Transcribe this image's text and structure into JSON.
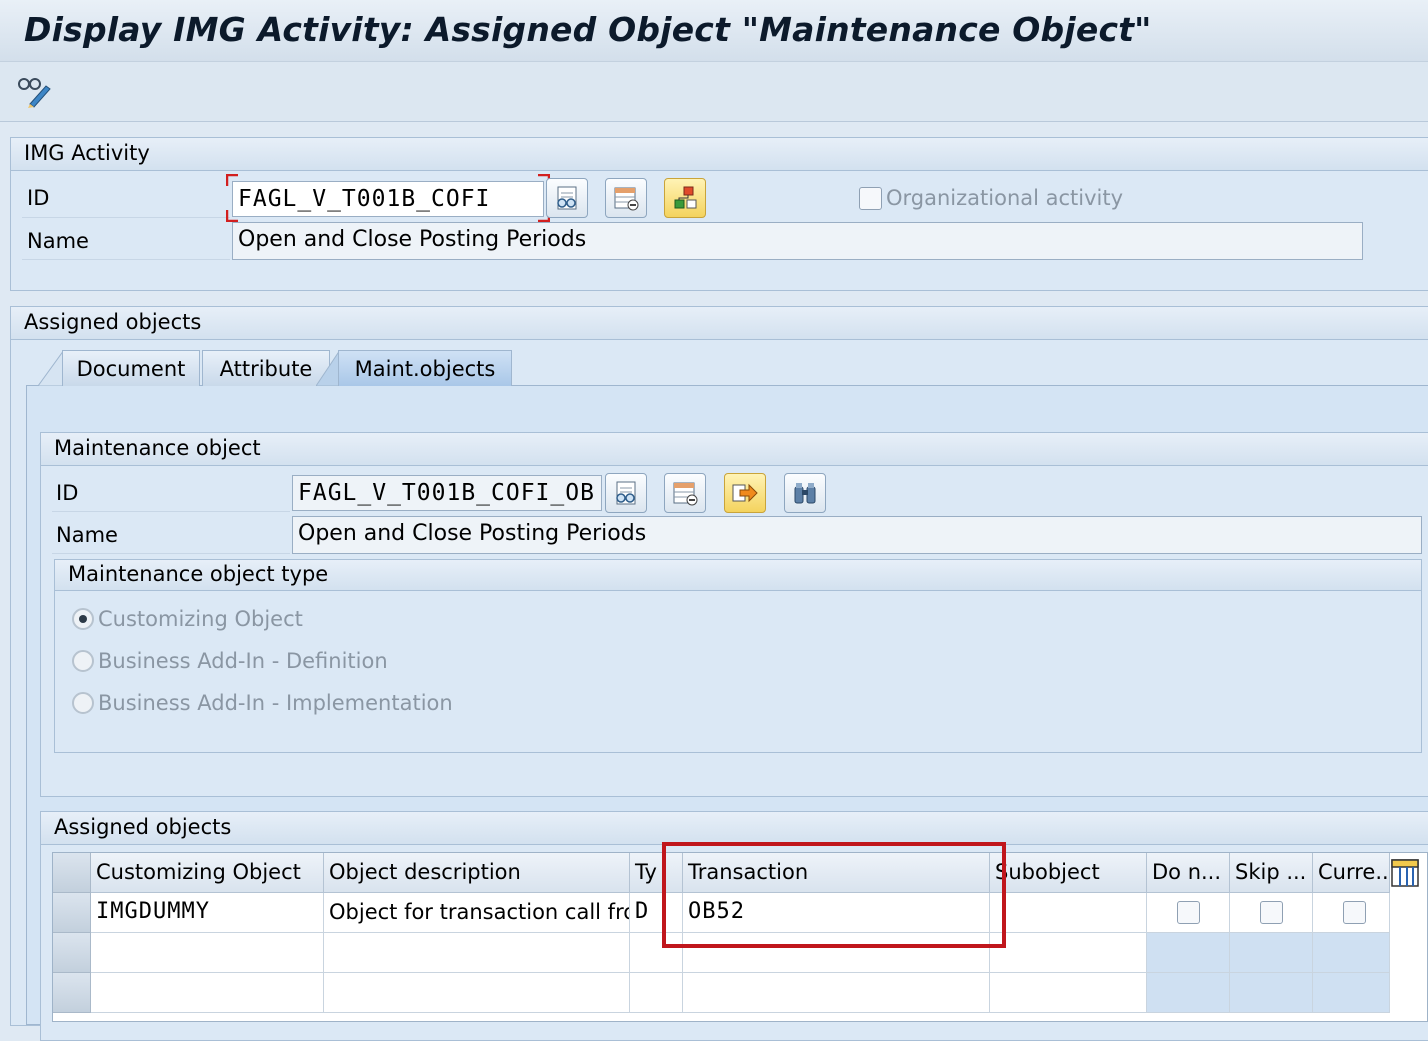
{
  "window": {
    "title": "Display IMG Activity: Assigned Object \"Maintenance Object\""
  },
  "img_activity": {
    "header": "IMG Activity",
    "id_label": "ID",
    "id_value": "FAGL_V_T001B_COFI",
    "name_label": "Name",
    "name_value": "Open and Close Posting Periods",
    "org_activity_label": "Organizational activity"
  },
  "assigned_objects_section": {
    "header": "Assigned objects",
    "tabs": [
      {
        "label": "Document"
      },
      {
        "label": "Attribute"
      },
      {
        "label": "Maint.objects"
      }
    ]
  },
  "maintenance_object": {
    "header": "Maintenance object",
    "id_label": "ID",
    "id_value": "FAGL_V_T001B_COFI_OB",
    "name_label": "Name",
    "name_value": "Open and Close Posting Periods",
    "type_group": {
      "header": "Maintenance object type",
      "options": [
        {
          "label": "Customizing Object",
          "selected": true
        },
        {
          "label": "Business Add-In - Definition",
          "selected": false
        },
        {
          "label": "Business Add-In - Implementation",
          "selected": false
        }
      ]
    }
  },
  "assigned_table": {
    "header": "Assigned objects",
    "columns": [
      "Customizing Object",
      "Object description",
      "Ty",
      "Transaction",
      "Subobject",
      "Do n...",
      "Skip ...",
      "Curre..."
    ],
    "rows": [
      {
        "object": "IMGDUMMY",
        "description": "Object for transaction call fro...",
        "type": "D",
        "transaction": "OB52",
        "subobject": ""
      }
    ]
  },
  "colors": {
    "highlight_box": "#c0161c",
    "required_corner": "#d21f1f",
    "section_bg": "#dbe8f5"
  }
}
